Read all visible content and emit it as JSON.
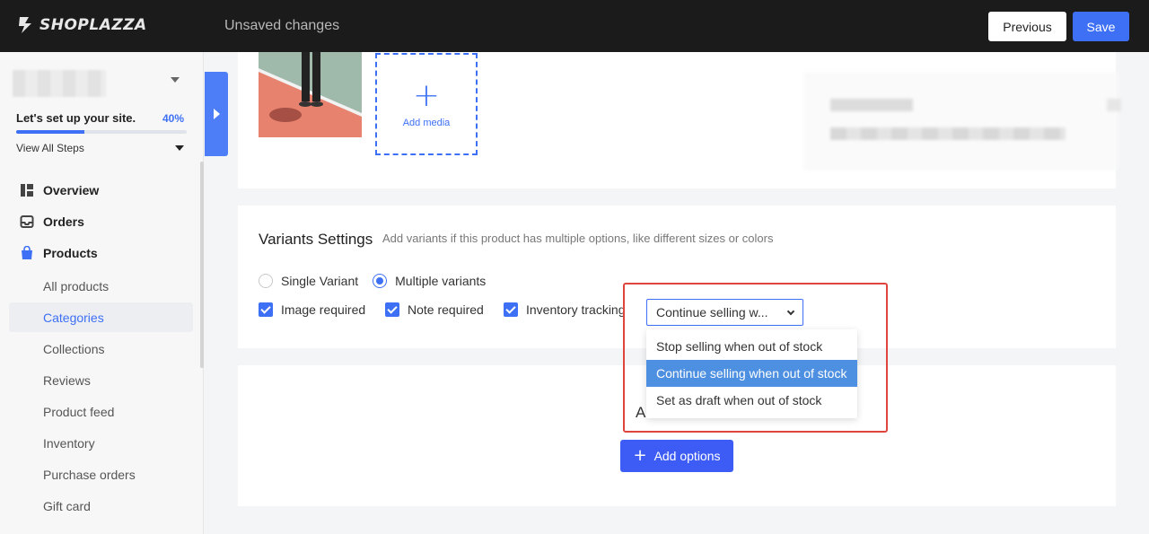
{
  "topbar": {
    "logo_text": "SHOPLAZZA",
    "status": "Unsaved changes",
    "previous_label": "Previous",
    "save_label": "Save"
  },
  "sidebar": {
    "setup_title": "Let's set up your site.",
    "setup_percent": "40%",
    "setup_progress": 0.4,
    "view_steps": "View All Steps",
    "nav": [
      {
        "label": "Overview",
        "icon": "dashboard-icon"
      },
      {
        "label": "Orders",
        "icon": "inbox-icon"
      },
      {
        "label": "Products",
        "icon": "shopping-bag-icon"
      }
    ],
    "sub_items": [
      {
        "label": "All products"
      },
      {
        "label": "Categories"
      },
      {
        "label": "Collections"
      },
      {
        "label": "Reviews"
      },
      {
        "label": "Product feed"
      },
      {
        "label": "Inventory"
      },
      {
        "label": "Purchase orders"
      },
      {
        "label": "Gift card"
      }
    ]
  },
  "media": {
    "add_media_label": "Add media"
  },
  "variants": {
    "title": "Variants Settings",
    "description": "Add variants if this product has multiple options, like different sizes or colors",
    "radio_single": "Single Variant",
    "radio_multiple": "Multiple variants",
    "check_image": "Image required",
    "check_note": "Note required",
    "check_inventory": "Inventory tracking",
    "select_value": "Continue selling w...",
    "dropdown_options": [
      "Stop selling when out of stock",
      "Continue selling when out of stock",
      "Set as draft when out of stock"
    ]
  },
  "options": {
    "partial_label": "A",
    "add_options_label": "Add options"
  },
  "colors": {
    "accent": "#3d70f5",
    "highlight": "#e0453d",
    "topbar": "#1b1b1b"
  }
}
